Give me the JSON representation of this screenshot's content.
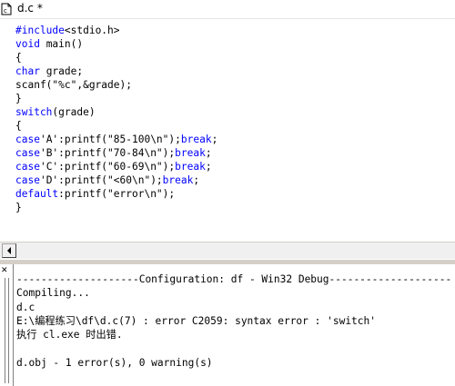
{
  "window": {
    "title": "d.c *",
    "icon": "c-source-file-icon"
  },
  "editor": {
    "lines": [
      [
        {
          "t": "#include",
          "k": true
        },
        {
          "t": "<stdio.h>",
          "k": false
        }
      ],
      [
        {
          "t": "void",
          "k": true
        },
        {
          "t": " main()",
          "k": false
        }
      ],
      [
        {
          "t": "{",
          "k": false
        }
      ],
      [
        {
          "t": "char",
          "k": true
        },
        {
          "t": " grade;",
          "k": false
        }
      ],
      [
        {
          "t": "scanf(\"%c\",&grade);",
          "k": false
        }
      ],
      [
        {
          "t": "}",
          "k": false
        }
      ],
      [
        {
          "t": "switch",
          "k": true
        },
        {
          "t": "(grade)",
          "k": false
        }
      ],
      [
        {
          "t": "{",
          "k": false
        }
      ],
      [
        {
          "t": "case",
          "k": true
        },
        {
          "t": "'A':printf(\"85-100\\n\");",
          "k": false
        },
        {
          "t": "break",
          "k": true
        },
        {
          "t": ";",
          "k": false
        }
      ],
      [
        {
          "t": "case",
          "k": true
        },
        {
          "t": "'B':printf(\"70-84\\n\");",
          "k": false
        },
        {
          "t": "break",
          "k": true
        },
        {
          "t": ";",
          "k": false
        }
      ],
      [
        {
          "t": "case",
          "k": true
        },
        {
          "t": "'C':printf(\"60-69\\n\");",
          "k": false
        },
        {
          "t": "break",
          "k": true
        },
        {
          "t": ";",
          "k": false
        }
      ],
      [
        {
          "t": "case",
          "k": true
        },
        {
          "t": "'D':printf(\"<60\\n\");",
          "k": false
        },
        {
          "t": "break",
          "k": true
        },
        {
          "t": ";",
          "k": false
        }
      ],
      [
        {
          "t": "default",
          "k": true
        },
        {
          "t": ":printf(\"error\\n\");",
          "k": false
        }
      ],
      [
        {
          "t": "}",
          "k": false
        }
      ]
    ],
    "keyword_color": "#0000ff",
    "text_color": "#000000"
  },
  "hscroll": {
    "left_button_icon": "scroll-left-arrow-icon"
  },
  "output": {
    "close_icon": "close-icon",
    "lines": [
      "--------------------Configuration: df - Win32 Debug--------------------",
      "Compiling...",
      "d.c",
      "E:\\编程练习\\df\\d.c(7) : error C2059: syntax error : 'switch'",
      "执行 cl.exe 时出错.",
      "",
      "d.obj - 1 error(s), 0 warning(s)"
    ]
  }
}
